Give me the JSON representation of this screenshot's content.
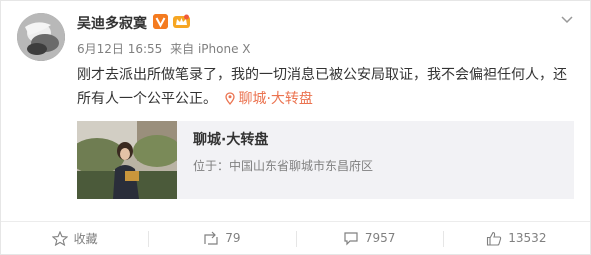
{
  "post": {
    "username": "吴迪多寂寞",
    "time": "6月12日 16:55",
    "source": "来自 iPhone X",
    "text": "刚才去派出所做笔录了，我的一切消息已被公安局取证，我不会偏袒任何人，还所有人一个公平公正。",
    "location_tag": "聊城·大转盘"
  },
  "place": {
    "title": "聊城·大转盘",
    "address": "位于：中国山东省聊城市东昌府区"
  },
  "actions": {
    "favorite": "收藏",
    "repost": "79",
    "comment": "7957",
    "like": "13532"
  },
  "colors": {
    "accent": "#eb7350",
    "verified": "#f47b20",
    "text": "#333333",
    "muted": "#808080"
  }
}
